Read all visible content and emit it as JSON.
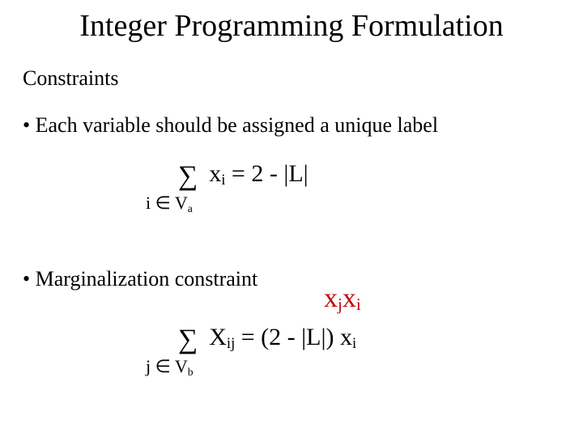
{
  "title": "Integer Programming Formulation",
  "subtitle": "Constraints",
  "bullets": {
    "b1": "• Each variable should be assigned a unique label",
    "b2": "• Marginalization constraint"
  },
  "eq1": {
    "sigma": "∑",
    "body_html": "x<sub>i</sub> = 2 - |L|",
    "under_html": "i ∈ V<sub>a</sub>"
  },
  "annotation_html": "x<sub>j</sub>x<sub>i</sub>",
  "eq2": {
    "sigma": "∑",
    "body_html": "X<sub>ij</sub> = (2 - |L|) x<sub>i</sub>",
    "under_html": "j ∈ V<sub>b</sub>"
  }
}
